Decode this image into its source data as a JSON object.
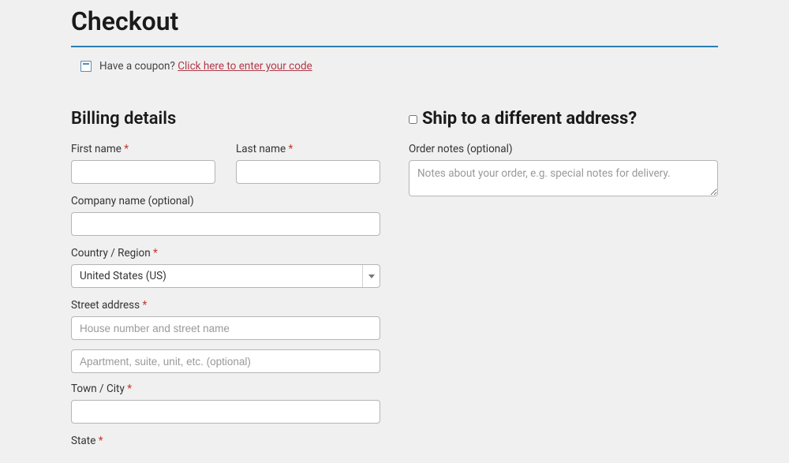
{
  "page": {
    "title": "Checkout"
  },
  "coupon": {
    "prompt": "Have a coupon?",
    "link": "Click here to enter your code"
  },
  "billing": {
    "heading": "Billing details",
    "first_name_label": "First name",
    "last_name_label": "Last name",
    "company_label": "Company name (optional)",
    "country_label": "Country / Region",
    "country_value": "United States (US)",
    "street_label": "Street address",
    "street1_placeholder": "House number and street name",
    "street2_placeholder": "Apartment, suite, unit, etc. (optional)",
    "city_label": "Town / City",
    "state_label": "State"
  },
  "shipping": {
    "heading": "Ship to a different address?",
    "notes_label": "Order notes (optional)",
    "notes_placeholder": "Notes about your order, e.g. special notes for delivery."
  },
  "required_marker": "*"
}
